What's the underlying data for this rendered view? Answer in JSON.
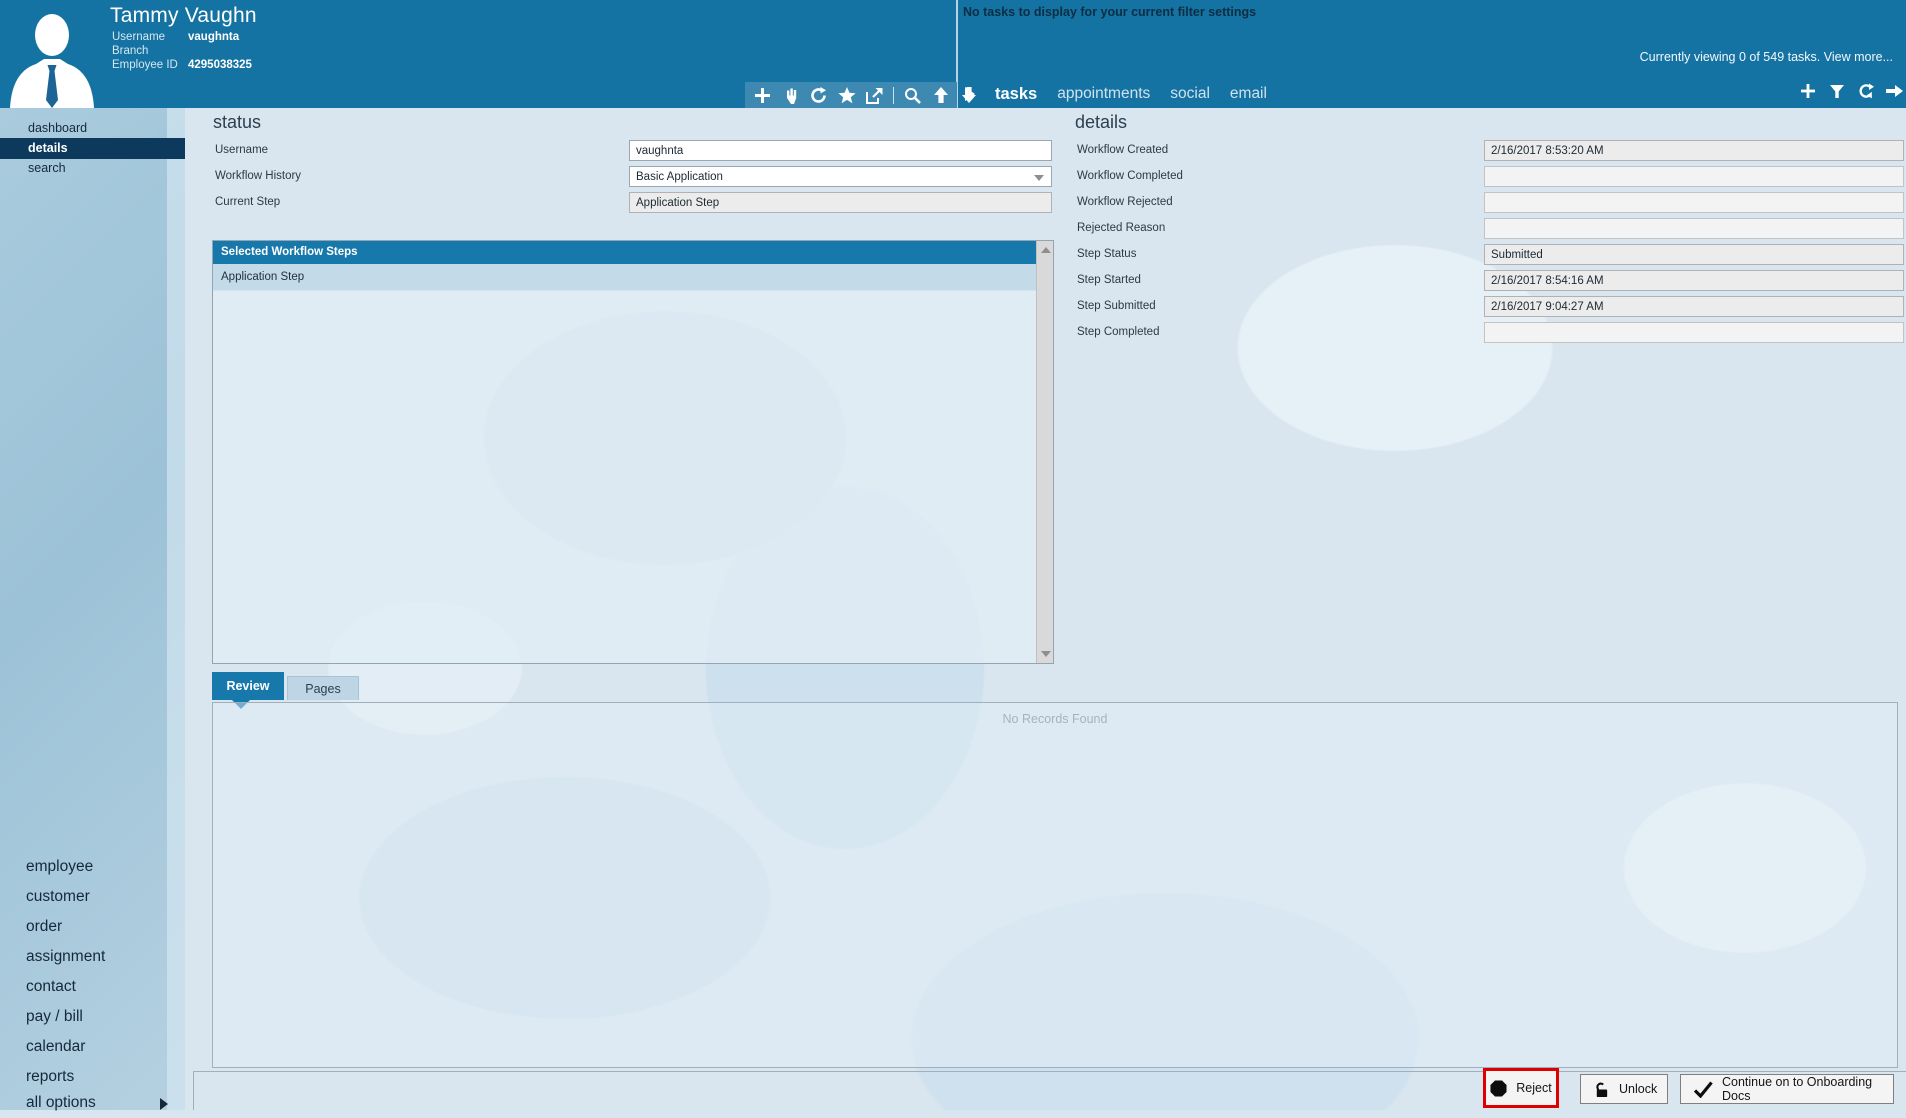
{
  "colors": {
    "header_blue": "#1573a3",
    "icon_band_blue": "#3e89b2",
    "selected_navy": "#0d3a5c",
    "accent_blue": "#1779ab",
    "highlight_red": "#de0000",
    "content_bg": "#d9e6f0"
  },
  "header": {
    "name": "Tammy Vaughn",
    "meta": [
      {
        "label": "Username",
        "value": "vaughnta"
      },
      {
        "label": "Branch",
        "value": ""
      },
      {
        "label": "Employee ID",
        "value": "4295038325"
      }
    ],
    "notice": "No tasks to display for your current filter settings",
    "viewing": "Currently viewing 0 of 549 tasks. View more...",
    "nav": [
      {
        "label": "tasks",
        "active": true
      },
      {
        "label": "appointments",
        "active": false
      },
      {
        "label": "social",
        "active": false
      },
      {
        "label": "email",
        "active": false
      }
    ]
  },
  "toolbar": {
    "left_icons": [
      "add",
      "hand-pointer",
      "refresh",
      "favorite",
      "open-external",
      "search",
      "move-up",
      "move-down"
    ],
    "right_icons": [
      "add",
      "filter",
      "refresh",
      "forward"
    ]
  },
  "sidebar": {
    "top": [
      {
        "label": "dashboard"
      },
      {
        "label": "details",
        "selected": true
      },
      {
        "label": "search"
      }
    ],
    "bottom": [
      {
        "label": "employee"
      },
      {
        "label": "customer"
      },
      {
        "label": "order"
      },
      {
        "label": "assignment"
      },
      {
        "label": "contact"
      },
      {
        "label": "pay / bill"
      },
      {
        "label": "calendar"
      },
      {
        "label": "reports"
      },
      {
        "label": "all options",
        "has_submenu": true
      }
    ]
  },
  "status": {
    "title": "status",
    "rows": [
      {
        "label": "Username",
        "value": "vaughnta",
        "type": "text"
      },
      {
        "label": "Workflow History",
        "value": "Basic Application",
        "type": "dropdown"
      },
      {
        "label": "Current Step",
        "value": "Application Step",
        "type": "readonly"
      }
    ]
  },
  "workflow_steps": {
    "header": "Selected Workflow Steps",
    "rows": [
      "Application Step"
    ]
  },
  "details": {
    "title": "details",
    "rows": [
      {
        "label": "Workflow Created",
        "value": "2/16/2017 8:53:20 AM"
      },
      {
        "label": "Workflow Completed",
        "value": ""
      },
      {
        "label": "Workflow Rejected",
        "value": ""
      },
      {
        "label": "Rejected Reason",
        "value": ""
      },
      {
        "label": "Step Status",
        "value": "Submitted"
      },
      {
        "label": "Step Started",
        "value": "2/16/2017 8:54:16 AM"
      },
      {
        "label": "Step Submitted",
        "value": "2/16/2017 9:04:27 AM"
      },
      {
        "label": "Step Completed",
        "value": ""
      }
    ]
  },
  "tabs": [
    {
      "label": "Review",
      "active": true
    },
    {
      "label": "Pages",
      "active": false
    }
  ],
  "review_panel": {
    "empty_text": "No Records Found"
  },
  "footer": {
    "buttons": [
      {
        "label": "Reject",
        "icon": "stop-octagon",
        "highlighted": true
      },
      {
        "label": "Unlock",
        "icon": "unlock"
      },
      {
        "label": "Continue on to Onboarding Docs",
        "icon": "check"
      }
    ]
  }
}
